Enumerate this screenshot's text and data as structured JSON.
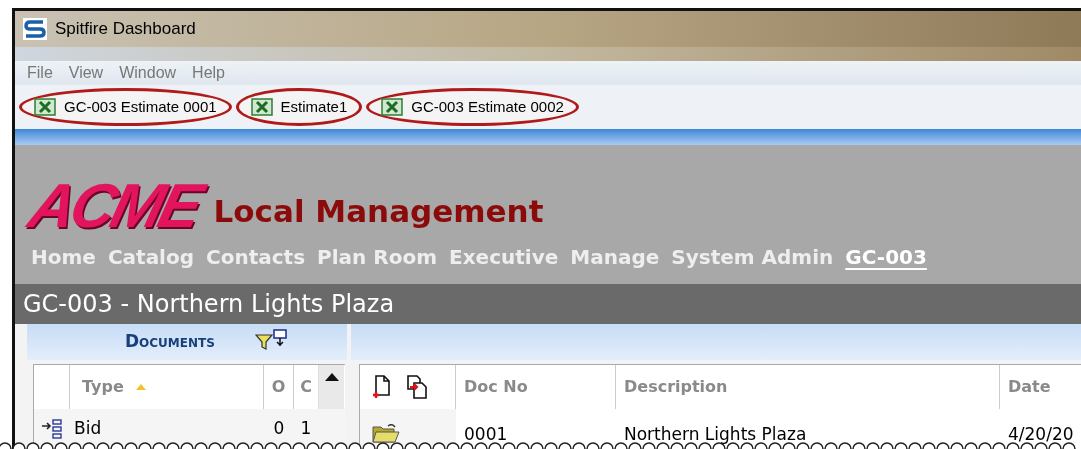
{
  "window": {
    "title": "Spitfire Dashboard"
  },
  "menu": [
    "File",
    "View",
    "Window",
    "Help"
  ],
  "tabs": [
    {
      "label": "GC-003 Estimate 0001",
      "circled": true
    },
    {
      "label": "Estimate1",
      "circled": true
    },
    {
      "label": "GC-003 Estimate 0002",
      "circled": true
    }
  ],
  "header": {
    "logo": "ACME",
    "app_name": "Local Management"
  },
  "nav": [
    {
      "label": "Home",
      "selected": false
    },
    {
      "label": "Catalog",
      "selected": false
    },
    {
      "label": "Contacts",
      "selected": false
    },
    {
      "label": "Plan Room",
      "selected": false
    },
    {
      "label": "Executive",
      "selected": false
    },
    {
      "label": "Manage",
      "selected": false
    },
    {
      "label": "System Admin",
      "selected": false
    },
    {
      "label": "GC-003",
      "selected": true
    }
  ],
  "page_title": "GC-003 - Northern Lights Plaza",
  "documents_panel": {
    "title": "Documents",
    "columns": [
      "Type",
      "O",
      "C"
    ],
    "sorted_ascending": true,
    "rows": [
      {
        "type": "Bid",
        "o": "0",
        "c": "1"
      }
    ]
  },
  "document_list": {
    "columns": [
      "Doc No",
      "Description",
      "Date"
    ],
    "rows": [
      {
        "doc_no": "0001",
        "description": "Northern Lights Plaza",
        "date": "4/20/20"
      }
    ]
  }
}
